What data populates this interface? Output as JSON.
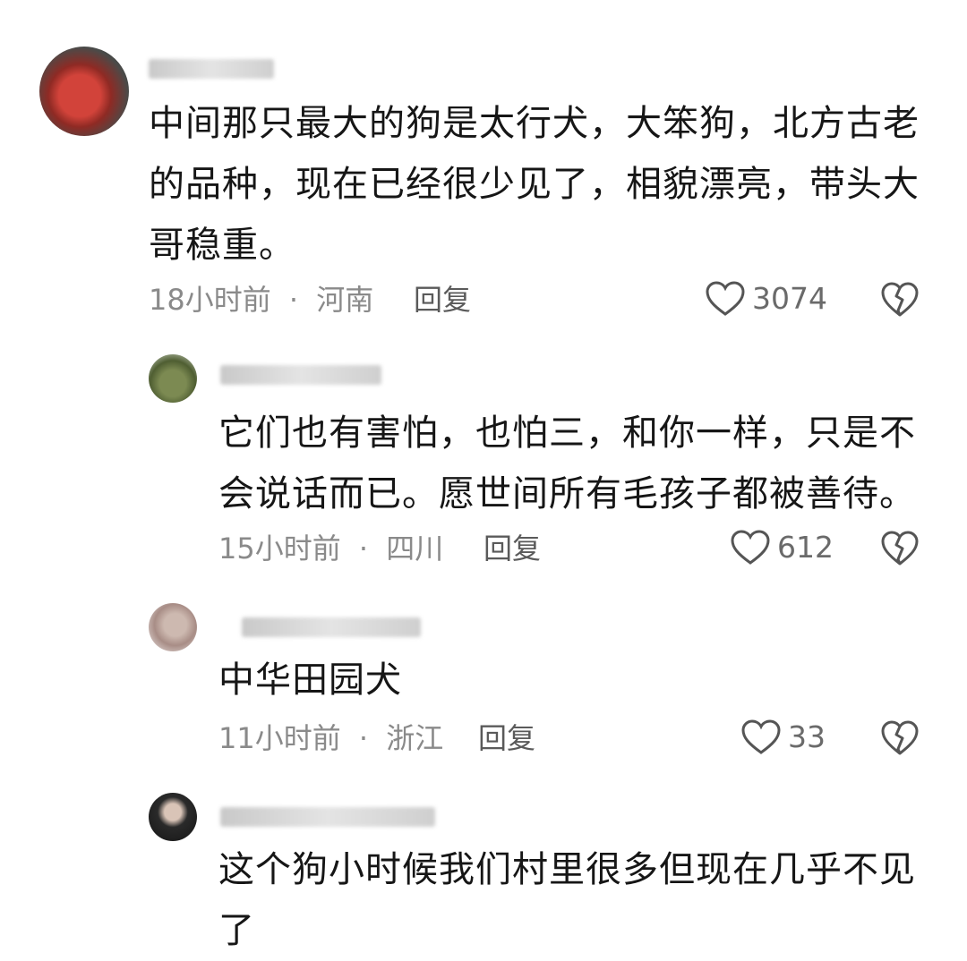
{
  "comments": [
    {
      "text_lines": [
        "中间那只最大的狗是太行犬，大笨狗，北方古老",
        "的品种，现在已经很少见了，相貌漂亮，带头大",
        "哥稳重。"
      ],
      "time": "18小时前",
      "location": "河南",
      "reply_label": "回复",
      "likes": "3074"
    },
    {
      "text_lines": [
        "它们也有害怕，也怕三，和你一样，只是不",
        "会说话而已。愿世间所有毛孩子都被善待。"
      ],
      "time": "15小时前",
      "location": "四川",
      "reply_label": "回复",
      "likes": "612"
    },
    {
      "text_lines": [
        "中华田园犬"
      ],
      "time": "11小时前",
      "location": "浙江",
      "reply_label": "回复",
      "likes": "33"
    },
    {
      "text_lines": [
        "这个狗小时候我们村里很多但现在几乎不见",
        "了"
      ]
    }
  ],
  "separator": "·",
  "icons": {
    "like": "heart-outline-icon",
    "dislike": "broken-heart-icon"
  }
}
